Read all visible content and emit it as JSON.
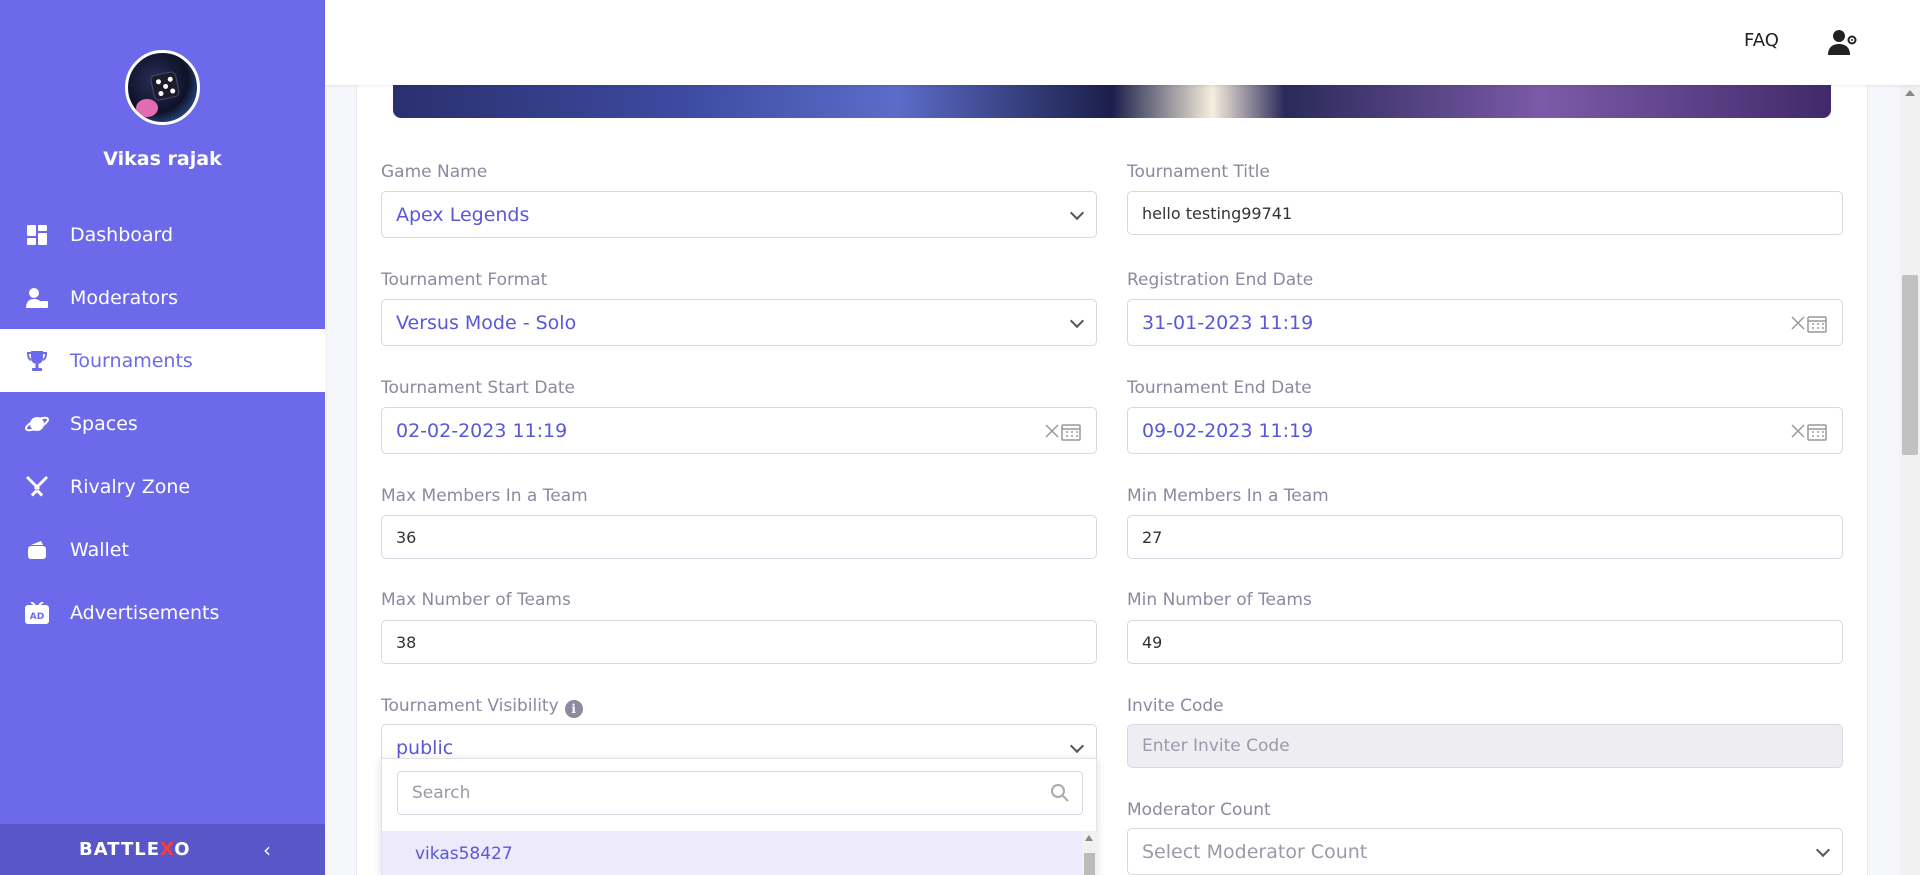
{
  "sidebar": {
    "user_name": "Vikas rajak",
    "items": [
      {
        "label": "Dashboard",
        "icon": "dashboard-icon"
      },
      {
        "label": "Moderators",
        "icon": "moderator-icon"
      },
      {
        "label": "Tournaments",
        "icon": "trophy-icon"
      },
      {
        "label": "Spaces",
        "icon": "planet-icon"
      },
      {
        "label": "Rivalry Zone",
        "icon": "crossed-swords-icon"
      },
      {
        "label": "Wallet",
        "icon": "wallet-icon"
      },
      {
        "label": "Advertisements",
        "icon": "ad-icon"
      }
    ],
    "active": "Tournaments",
    "brand_prefix": "BATTLE",
    "brand_x": "X",
    "brand_suffix": "O"
  },
  "header": {
    "faq": "FAQ",
    "user_icon": "user-settings-icon"
  },
  "form": {
    "game_name": {
      "label": "Game Name",
      "value": "Apex Legends"
    },
    "tournament_title": {
      "label": "Tournament Title",
      "value": "hello testing99741"
    },
    "tournament_format": {
      "label": "Tournament Format",
      "value": "Versus Mode - Solo"
    },
    "registration_end": {
      "label": "Registration End Date",
      "value": "31-01-2023 11:19"
    },
    "start_date": {
      "label": "Tournament Start Date",
      "value": "02-02-2023 11:19"
    },
    "end_date": {
      "label": "Tournament End Date",
      "value": "09-02-2023 11:19"
    },
    "max_members": {
      "label": "Max Members In a Team",
      "value": "36"
    },
    "min_members": {
      "label": "Min Members In a Team",
      "value": "27"
    },
    "max_teams": {
      "label": "Max Number of Teams",
      "value": "38"
    },
    "min_teams": {
      "label": "Min Number of Teams",
      "value": "49"
    },
    "visibility": {
      "label": "Tournament Visibility",
      "value": "public"
    },
    "invite_code": {
      "label": "Invite Code",
      "placeholder": "Enter Invite Code"
    },
    "moderator_count": {
      "label": "Moderator Count",
      "placeholder": "Select Moderator Count"
    }
  },
  "dropdown": {
    "search_placeholder": "Search",
    "options": [
      "vikas58427"
    ]
  },
  "colors": {
    "sidebar": "#6c6aeb",
    "accent": "#5a57d8",
    "brand_x": "#ff3b3b"
  }
}
